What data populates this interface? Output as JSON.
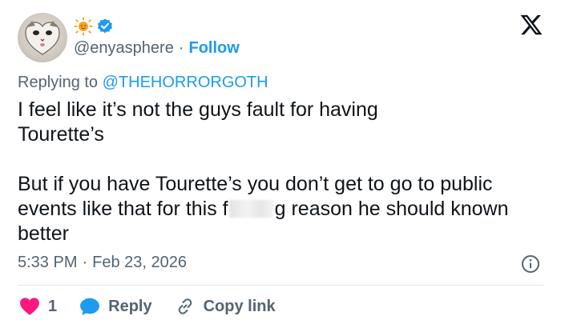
{
  "author": {
    "handle": "@enyasphere",
    "separator": "·",
    "follow_label": "Follow"
  },
  "reply_to": {
    "prefix": "Replying to",
    "mention": "@THEHORRORGOTH"
  },
  "tweet": {
    "line1": "I feel like it’s not the guys fault for having Tourette’s",
    "line2_before": "But if you have Tourette’s you don’t get to go to public events like that for this f",
    "line2_after": "g reason he should known better"
  },
  "timestamp": {
    "time": "5:33 PM",
    "separator": "·",
    "date": "Feb 23, 2026"
  },
  "actions": {
    "like_count": "1",
    "reply_label": "Reply",
    "copy_label": "Copy link"
  },
  "icons": {
    "sun": "sun-emoji-icon",
    "verified": "verified-badge-icon",
    "x": "x-logo-icon",
    "info": "info-icon",
    "heart": "heart-icon",
    "reply": "reply-bubble-icon",
    "link": "link-icon"
  },
  "colors": {
    "accent": "#1d9bf0",
    "like": "#f91880",
    "muted": "#536471",
    "text": "#0f1419"
  }
}
